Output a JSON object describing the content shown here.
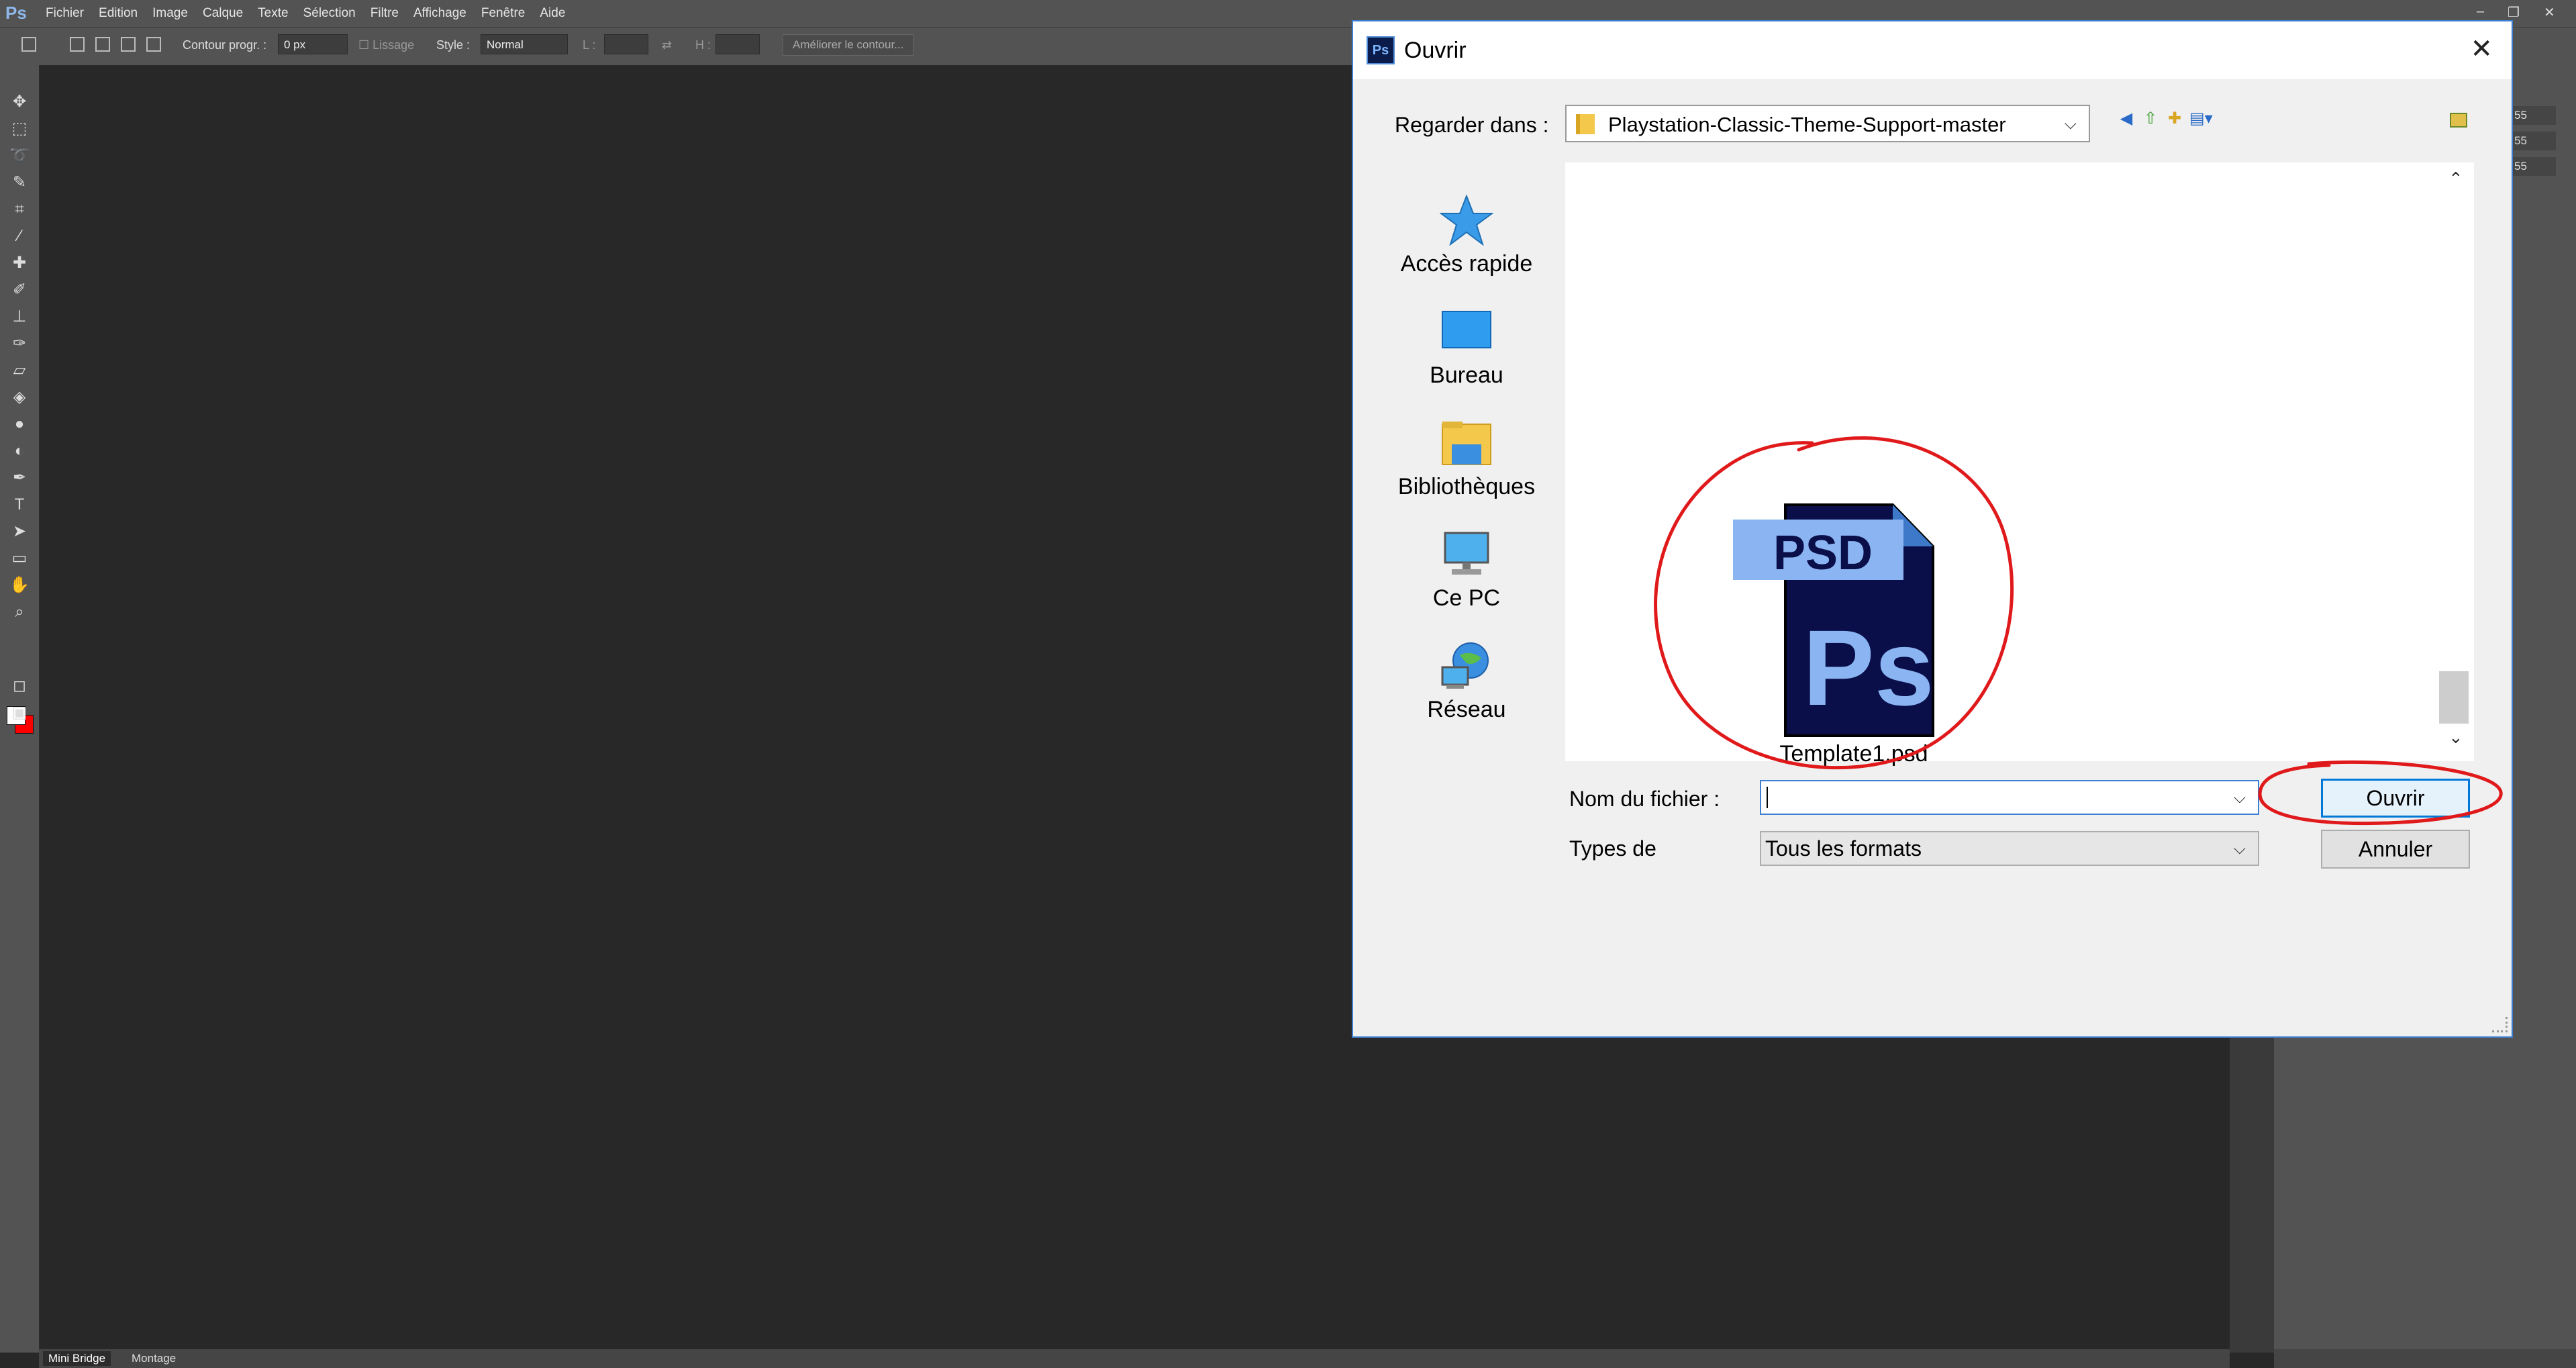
{
  "photoshop": {
    "logo": "Ps",
    "menu": [
      "Fichier",
      "Edition",
      "Image",
      "Calque",
      "Texte",
      "Sélection",
      "Filtre",
      "Affichage",
      "Fenêtre",
      "Aide"
    ],
    "options": {
      "contour_label": "Contour progr. :",
      "contour_value": "0 px",
      "lissage_label": "Lissage",
      "style_label": "Style :",
      "style_value": "Normal",
      "l_label": "L :",
      "h_label": "H :",
      "refine_button": "Améliorer le contour..."
    },
    "panel_values": [
      "55",
      "55",
      "55"
    ],
    "status_tabs": [
      "Mini Bridge",
      "Montage"
    ],
    "colors": {
      "foreground": "#ffffff",
      "background": "#ff0000"
    }
  },
  "dialog": {
    "title": "Ouvrir",
    "icon_text": "Ps",
    "look_in_label": "Regarder dans :",
    "look_in_value": "Playstation-Classic-Theme-Support-master",
    "places": [
      {
        "label": "Accès rapide",
        "icon": "star-icon"
      },
      {
        "label": "Bureau",
        "icon": "desktop-icon"
      },
      {
        "label": "Bibliothèques",
        "icon": "libraries-icon"
      },
      {
        "label": "Ce PC",
        "icon": "computer-icon"
      },
      {
        "label": "Réseau",
        "icon": "network-icon"
      }
    ],
    "file": {
      "name": "Template1.psd",
      "badge": "PSD",
      "glyph": "Ps"
    },
    "filename_label": "Nom du fichier :",
    "filename_value": "",
    "types_label": "Types de",
    "types_value": "Tous les formats",
    "open_button": "Ouvrir",
    "cancel_button": "Annuler",
    "annotation_color": "#e0191b"
  }
}
